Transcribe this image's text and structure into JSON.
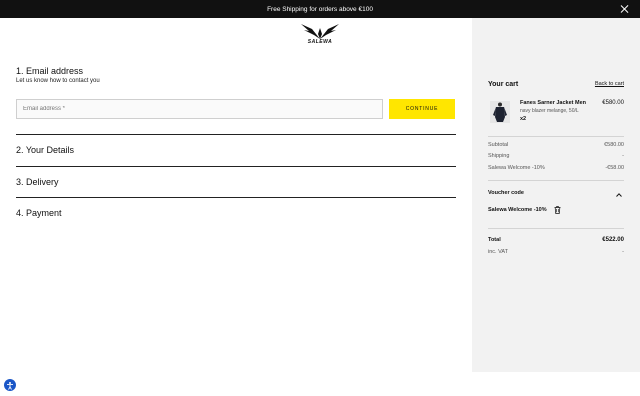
{
  "topbar": {
    "promo": "Free Shipping for orders above €100"
  },
  "logo": {
    "brand": "SALEWA"
  },
  "checkout": {
    "email_step_title": "1. Email address",
    "email_step_subtitle": "Let us know how to contact you",
    "email_placeholder": "Email address *",
    "continue_label": "CONTINUE",
    "steps": [
      "2. Your Details",
      "3. Delivery",
      "4. Payment"
    ]
  },
  "cart": {
    "title": "Your cart",
    "back_link": "Back to cart",
    "item": {
      "name": "Fanes Sarner Jacket Men",
      "variant": "navy blazer melange, 50/L",
      "qty": "x2",
      "price": "€580.00"
    },
    "subtotal_label": "Subtotal",
    "subtotal_value": "€580.00",
    "shipping_label": "Shipping",
    "shipping_value": "-",
    "discount_label": "Salewa Welcome -10%",
    "discount_value": "-€58.00",
    "voucher_label": "Voucher code",
    "voucher_applied": "Salewa Welcome -10%",
    "total_label": "Total",
    "total_value": "€522.00",
    "vat_label": "inc. VAT",
    "vat_value": "-"
  },
  "colors": {
    "accent_yellow": "#ffe600",
    "topbar": "#111111",
    "sidebar_bg": "#f2f2f2",
    "a11y_blue": "#1a56c7"
  }
}
